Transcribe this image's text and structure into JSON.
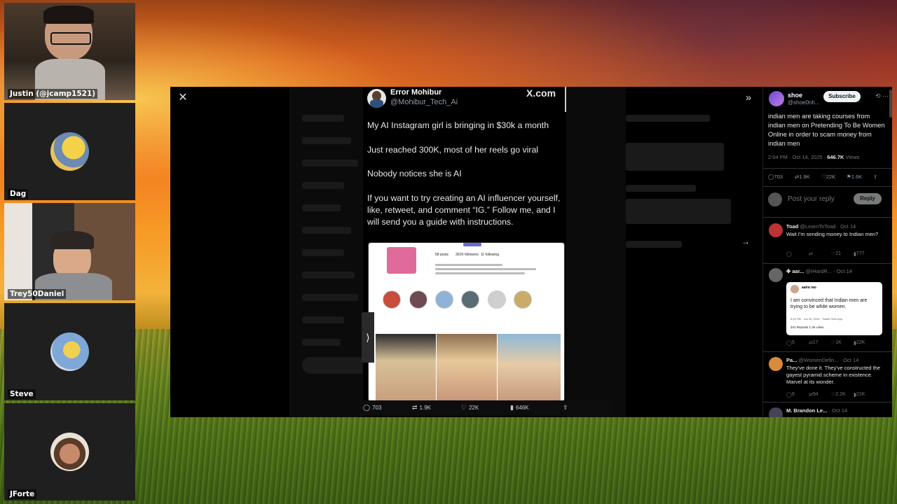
{
  "cams": [
    {
      "name": "Justin (@jcamp1521)"
    },
    {
      "name": "Dag"
    },
    {
      "name": "Trey50Daniel"
    },
    {
      "name": "Steve"
    },
    {
      "name": "JForte"
    }
  ],
  "viewer": {
    "close_icon": "✕",
    "expand_icon": "»",
    "arrow_icon": "→",
    "toggle_icon": "⟩"
  },
  "tweet": {
    "author": "Error Mohibur",
    "handle": "@Mohibur_Tech_Ai",
    "brand": "X.com",
    "lines": [
      "My AI Instagram girl is bringing in $30k a month",
      "Just reached 300K, most of her reels go viral",
      "Nobody notices she is AI",
      "If you want to try creating an AI influencer yourself, like, retweet, and comment “IG.” Follow me, and I will send you a guide with instructions."
    ],
    "ig": {
      "posts": "58 posts",
      "followers": "301K followers",
      "following": "11 following"
    },
    "actions": {
      "replies": "703",
      "reposts": "1.9K",
      "likes": "22K",
      "views": "646K"
    }
  },
  "panel": {
    "author": "shoe",
    "handle": "@shoe0nh...",
    "subscribe": "Subscribe",
    "text": "indian men are taking courses from indian men on Pretending To Be Women Online in order to scam money from indian men",
    "time": "2:04 PM · Oct 14, 2025 · ",
    "views": "646.7K",
    "views_label": " Views",
    "stats": {
      "replies": "703",
      "reposts": "1.9K",
      "likes": "22K",
      "bookmarks": "1.6K"
    },
    "reply_placeholder": "Post your reply",
    "reply_button": "Reply",
    "replies": [
      {
        "name": "Toad",
        "meta": "@LearnToToad · Oct 14",
        "text": "Wait I'm sending money to Indian men?",
        "stats": [
          "",
          "",
          "21",
          "777"
        ]
      },
      {
        "name": "✤ aar...",
        "meta": "@IHardR... · Oct 14",
        "text": "",
        "stats": [
          "5",
          "17",
          "1K",
          "22K"
        ],
        "quote": {
          "name": "aaira rao",
          "text": "I am convinced that Indian men are trying to be white women.",
          "meta": "5:40 PM · Jun 30, 2025 · Twitter Web App",
          "stats": "341 Reposts   1.3K Likes"
        }
      },
      {
        "name": "Pa...",
        "meta": "@WomenDefin... · Oct 14",
        "text": "They've done it. They've constructed the gayest pyramid scheme in existence. Marvel at its wonder.",
        "stats": [
          "9",
          "94",
          "2.2K",
          "21K"
        ]
      },
      {
        "name": "M. Brandon Le...",
        "meta": "· Oct 14",
        "text": "",
        "stats": [
          "",
          "",
          "",
          ""
        ]
      }
    ]
  },
  "colors": {
    "accent": "#1d9bf0",
    "bg": "#000000"
  }
}
